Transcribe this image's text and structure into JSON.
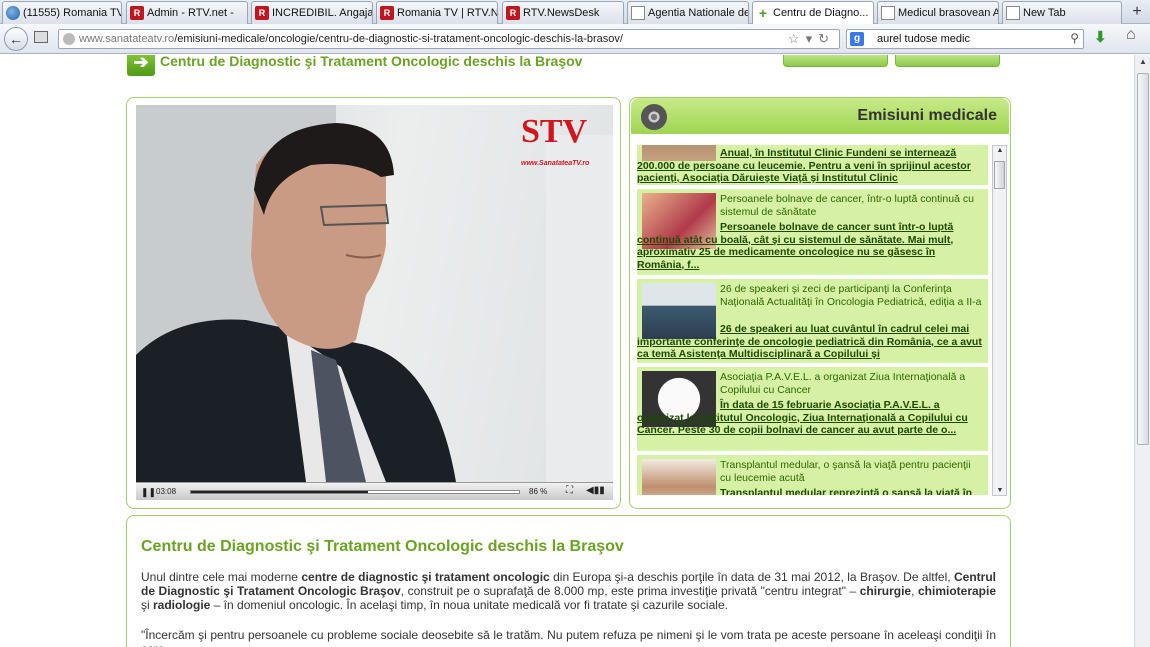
{
  "browser": {
    "tabs": [
      {
        "label": "(11555) Romania TV ...",
        "icon": "globe"
      },
      {
        "label": "Admin - RTV.net -",
        "icon": "r"
      },
      {
        "label": "INCREDIBIL. Angajat...",
        "icon": "r"
      },
      {
        "label": "Romania TV | RTV.NE...",
        "icon": "r"
      },
      {
        "label": "RTV.NewsDesk",
        "icon": "r"
      },
      {
        "label": "Agentia Nationale de ...",
        "icon": "doc"
      },
      {
        "label": "Centru de Diagno...",
        "icon": "plus",
        "active": true
      },
      {
        "label": "Medicul brasovean A...",
        "icon": "doc"
      },
      {
        "label": "New Tab",
        "icon": "doc"
      }
    ],
    "url_domain": "www.sanatateatv.ro",
    "url_path": "/emisiuni-medicale/oncologie/centru-de-diagnostic-si-tratament-oncologic-deschis-la-brasov/",
    "search_engine": "g",
    "search_value": "aurel tudose medic"
  },
  "header": {
    "title": "Centru de Diagnostic şi Tratament Oncologic deschis la Braşov"
  },
  "video": {
    "logo": "STV",
    "logo_sub": "www.SanatateaTV.ro",
    "time": "03:08",
    "volume": "86 %",
    "progress": 0.54
  },
  "emisiuni": {
    "title": "Emisiuni medicale",
    "items": [
      {
        "title": "",
        "desc": "Anual, în Institutul Clinic Fundeni se internează 200.000 de persoane cu leucemie. Pentru a veni în sprijinul acestor pacienţi, Asociaţia Dăruieşte Viaţă şi Institutul Clinic"
      },
      {
        "title": "Persoanele bolnave de cancer, într-o luptă continuă cu sistemul de sănătate",
        "desc": "Persoanele bolnave de cancer sunt într-o luptă continuă atât cu boală, cât şi cu sistemul de sănătate. Mai mult, aproximativ 25 de medicamente oncologice nu se găsesc în România, f..."
      },
      {
        "title": "26 de speakeri şi zeci de participanţi la Conferinţa Naţională Actualităţi în Oncologia Pediatrică, ediţia a II-a",
        "desc": "26 de speakeri au luat cuvântul în cadrul celei mai importante conferinţe de oncologie pediatrică din România, ce a avut ca temă Asistenţa Multidisciplinară a Copilului şi"
      },
      {
        "title": "Asociaţia P.A.V.E.L. a organizat Ziua Internaţională a Copilului cu Cancer",
        "desc": "În data de 15 februarie Asociaţia P.A.V.E.L. a organizat la Institutul Oncologic, Ziua Internaţională a Copilului cu Cancer. Peste 30 de copii bolnavi de cancer au avut parte de o..."
      },
      {
        "title": "Transplantul medular, o şansă la viaţă pentru pacienţii cu leucemie acută",
        "desc": "Transplantul medular reprezintă o şansă la viaţă în"
      }
    ]
  },
  "article": {
    "title": "Centru de Diagnostic şi Tratament Oncologic deschis la Braşov",
    "p1_a": "Unul dintre cele mai moderne ",
    "p1_b": "centre de diagnostic şi tratament oncologic",
    "p1_c": " din Europa şi-a deschis porţile în data de 31 mai 2012, la Braşov. De altfel, ",
    "p1_d": "Centrul de Diagnostic şi Tratament Oncologic Braşov",
    "p1_e": ", construit pe o suprafaţă de 8.000 mp, este prima investiţie privată \"centru integrat\" – ",
    "p1_f": "chirurgie",
    "p1_g": ", ",
    "p1_h": "chimioterapie",
    "p1_i": " şi ",
    "p1_j": "radiologie",
    "p1_k": " – în domeniul oncologic. În acelaşi timp, în noua unitate medicală vor fi tratate şi cazurile sociale.",
    "p2": "\"Încercăm şi pentru persoanele cu probleme sociale deosebite să le tratăm. Nu putem refuza pe nimeni şi le vom trata pe aceste persoane în aceleaşi condiţii în care"
  }
}
